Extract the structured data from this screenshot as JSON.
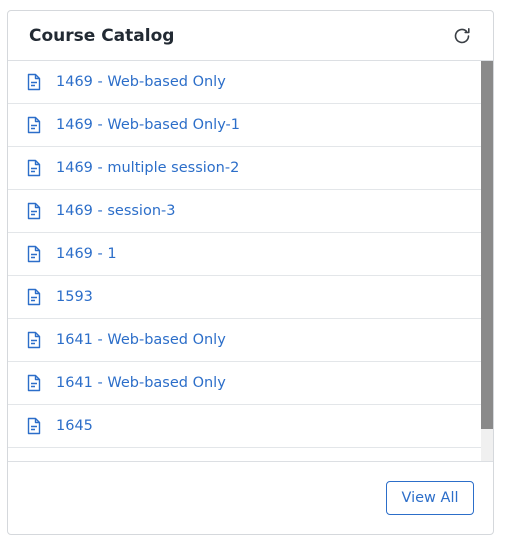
{
  "header": {
    "title": "Course Catalog",
    "refresh_icon": "refresh-icon"
  },
  "courses": [
    {
      "label": "1469 - Web-based Only",
      "icon": "document-icon"
    },
    {
      "label": "1469 - Web-based Only-1",
      "icon": "document-icon"
    },
    {
      "label": "1469 - multiple session-2",
      "icon": "document-icon"
    },
    {
      "label": "1469 - session-3",
      "icon": "document-icon"
    },
    {
      "label": "1469 - 1",
      "icon": "document-icon"
    },
    {
      "label": "1593",
      "icon": "document-icon"
    },
    {
      "label": "1641 - Web-based Only",
      "icon": "document-icon"
    },
    {
      "label": "1641 - Web-based Only",
      "icon": "document-icon"
    },
    {
      "label": "1645",
      "icon": "document-icon"
    }
  ],
  "footer": {
    "view_all_label": "View All"
  },
  "colors": {
    "link": "#2c6ec9",
    "title": "#222a33",
    "border": "#d5d8dc",
    "scroll_thumb": "#8a8a8a"
  }
}
